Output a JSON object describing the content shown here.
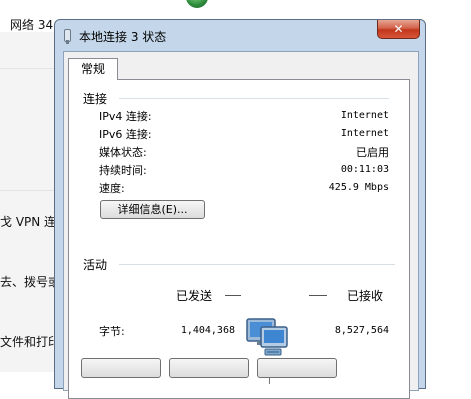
{
  "background": {
    "top_text": "网络  34",
    "items": [
      "戈 VPN 连接",
      "去、拨号或",
      "文件和打印"
    ]
  },
  "dialog": {
    "title": "本地连接 3 状态",
    "close_glyph": "✕",
    "tab": "常规",
    "connection": {
      "heading": "连接",
      "rows": [
        {
          "label": "IPv4 连接:",
          "value": "Internet"
        },
        {
          "label": "IPv6 连接:",
          "value": "Internet"
        },
        {
          "label": "媒体状态:",
          "value": "已启用"
        },
        {
          "label": "持续时间:",
          "value": "00:11:03"
        },
        {
          "label": "速度:",
          "value": "425.9 Mbps"
        }
      ],
      "details_button": "详细信息(E)..."
    },
    "activity": {
      "heading": "活动",
      "sent_label": "已发送",
      "received_label": "已接收",
      "bytes_label": "字节:",
      "bytes_sent": "1,404,368",
      "bytes_received": "8,527,564"
    }
  },
  "colors": {
    "dialog_frame": "#c4d7ea",
    "close_button": "#c2361b",
    "panel_bg": "#ffffff"
  },
  "icons": {
    "title": "network-adapter-icon",
    "activity": "network-computers-icon"
  }
}
